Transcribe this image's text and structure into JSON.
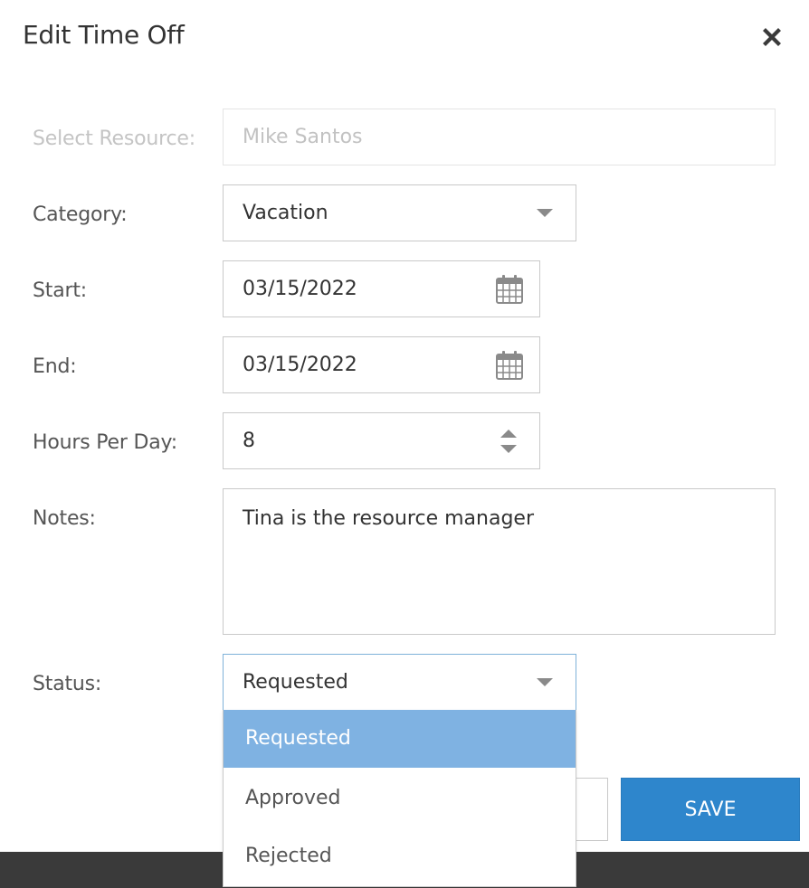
{
  "dialog": {
    "title": "Edit Time Off",
    "close_icon": "close-icon"
  },
  "form": {
    "resource": {
      "label": "Select Resource:",
      "value": "Mike Santos",
      "disabled": true
    },
    "category": {
      "label": "Category:",
      "value": "Vacation"
    },
    "start": {
      "label": "Start:",
      "value": "03/15/2022",
      "icon": "calendar-icon"
    },
    "end": {
      "label": "End:",
      "value": "03/15/2022",
      "icon": "calendar-icon"
    },
    "hours_per_day": {
      "label": "Hours Per Day:",
      "value": "8",
      "icon": "spinner-arrows-icon"
    },
    "notes": {
      "label": "Notes:",
      "value": "Tina is the resource manager"
    },
    "status": {
      "label": "Status:",
      "value": "Requested",
      "options": [
        "Requested",
        "Approved",
        "Rejected"
      ],
      "selected_option": "Requested"
    }
  },
  "actions": {
    "save_label": "SAVE"
  },
  "colors": {
    "accent": "#2e86cc",
    "selected_option_bg": "#7fb2e2",
    "footer": "#3a3a3a"
  }
}
